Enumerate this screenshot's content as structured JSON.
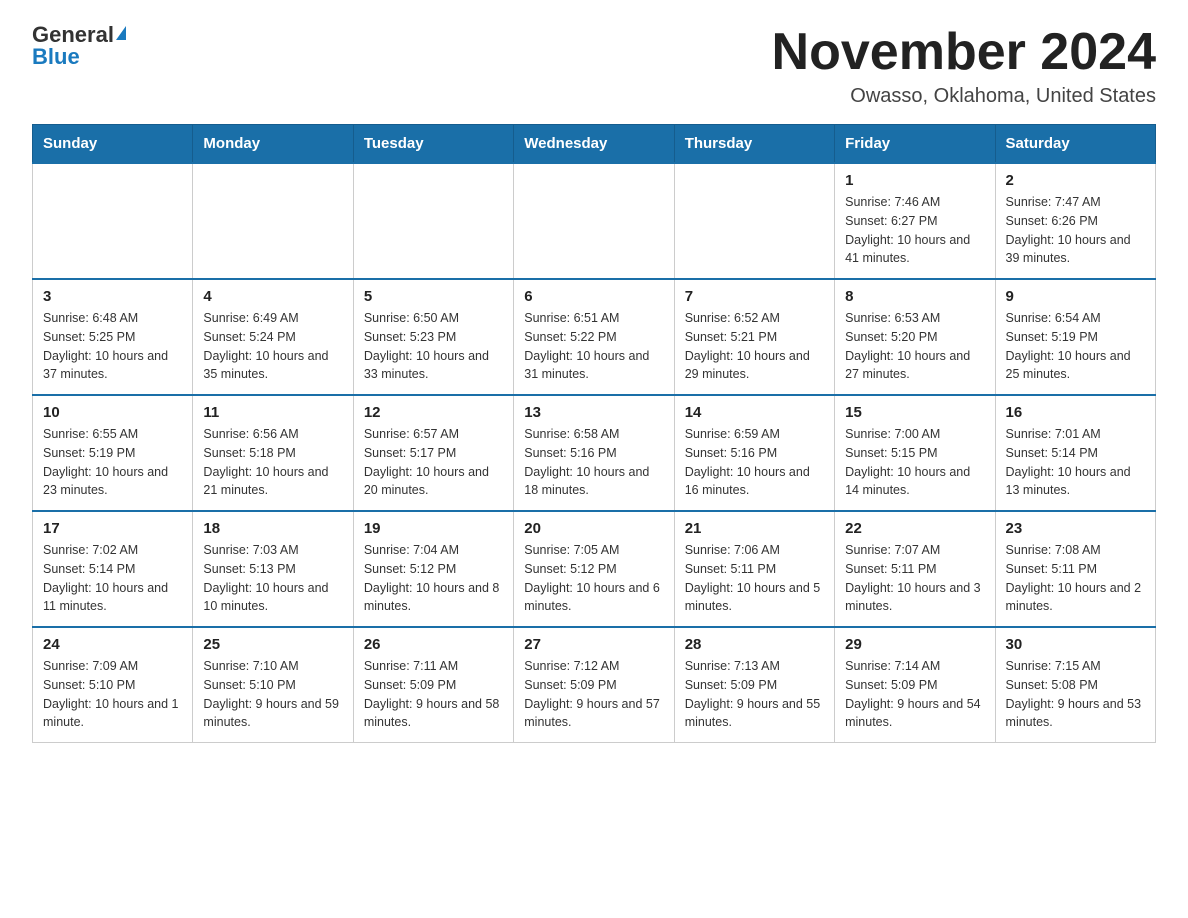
{
  "logo": {
    "general": "General",
    "blue": "Blue"
  },
  "title": "November 2024",
  "subtitle": "Owasso, Oklahoma, United States",
  "days_of_week": [
    "Sunday",
    "Monday",
    "Tuesday",
    "Wednesday",
    "Thursday",
    "Friday",
    "Saturday"
  ],
  "weeks": [
    [
      {
        "day": "",
        "info": ""
      },
      {
        "day": "",
        "info": ""
      },
      {
        "day": "",
        "info": ""
      },
      {
        "day": "",
        "info": ""
      },
      {
        "day": "",
        "info": ""
      },
      {
        "day": "1",
        "info": "Sunrise: 7:46 AM\nSunset: 6:27 PM\nDaylight: 10 hours and 41 minutes."
      },
      {
        "day": "2",
        "info": "Sunrise: 7:47 AM\nSunset: 6:26 PM\nDaylight: 10 hours and 39 minutes."
      }
    ],
    [
      {
        "day": "3",
        "info": "Sunrise: 6:48 AM\nSunset: 5:25 PM\nDaylight: 10 hours and 37 minutes."
      },
      {
        "day": "4",
        "info": "Sunrise: 6:49 AM\nSunset: 5:24 PM\nDaylight: 10 hours and 35 minutes."
      },
      {
        "day": "5",
        "info": "Sunrise: 6:50 AM\nSunset: 5:23 PM\nDaylight: 10 hours and 33 minutes."
      },
      {
        "day": "6",
        "info": "Sunrise: 6:51 AM\nSunset: 5:22 PM\nDaylight: 10 hours and 31 minutes."
      },
      {
        "day": "7",
        "info": "Sunrise: 6:52 AM\nSunset: 5:21 PM\nDaylight: 10 hours and 29 minutes."
      },
      {
        "day": "8",
        "info": "Sunrise: 6:53 AM\nSunset: 5:20 PM\nDaylight: 10 hours and 27 minutes."
      },
      {
        "day": "9",
        "info": "Sunrise: 6:54 AM\nSunset: 5:19 PM\nDaylight: 10 hours and 25 minutes."
      }
    ],
    [
      {
        "day": "10",
        "info": "Sunrise: 6:55 AM\nSunset: 5:19 PM\nDaylight: 10 hours and 23 minutes."
      },
      {
        "day": "11",
        "info": "Sunrise: 6:56 AM\nSunset: 5:18 PM\nDaylight: 10 hours and 21 minutes."
      },
      {
        "day": "12",
        "info": "Sunrise: 6:57 AM\nSunset: 5:17 PM\nDaylight: 10 hours and 20 minutes."
      },
      {
        "day": "13",
        "info": "Sunrise: 6:58 AM\nSunset: 5:16 PM\nDaylight: 10 hours and 18 minutes."
      },
      {
        "day": "14",
        "info": "Sunrise: 6:59 AM\nSunset: 5:16 PM\nDaylight: 10 hours and 16 minutes."
      },
      {
        "day": "15",
        "info": "Sunrise: 7:00 AM\nSunset: 5:15 PM\nDaylight: 10 hours and 14 minutes."
      },
      {
        "day": "16",
        "info": "Sunrise: 7:01 AM\nSunset: 5:14 PM\nDaylight: 10 hours and 13 minutes."
      }
    ],
    [
      {
        "day": "17",
        "info": "Sunrise: 7:02 AM\nSunset: 5:14 PM\nDaylight: 10 hours and 11 minutes."
      },
      {
        "day": "18",
        "info": "Sunrise: 7:03 AM\nSunset: 5:13 PM\nDaylight: 10 hours and 10 minutes."
      },
      {
        "day": "19",
        "info": "Sunrise: 7:04 AM\nSunset: 5:12 PM\nDaylight: 10 hours and 8 minutes."
      },
      {
        "day": "20",
        "info": "Sunrise: 7:05 AM\nSunset: 5:12 PM\nDaylight: 10 hours and 6 minutes."
      },
      {
        "day": "21",
        "info": "Sunrise: 7:06 AM\nSunset: 5:11 PM\nDaylight: 10 hours and 5 minutes."
      },
      {
        "day": "22",
        "info": "Sunrise: 7:07 AM\nSunset: 5:11 PM\nDaylight: 10 hours and 3 minutes."
      },
      {
        "day": "23",
        "info": "Sunrise: 7:08 AM\nSunset: 5:11 PM\nDaylight: 10 hours and 2 minutes."
      }
    ],
    [
      {
        "day": "24",
        "info": "Sunrise: 7:09 AM\nSunset: 5:10 PM\nDaylight: 10 hours and 1 minute."
      },
      {
        "day": "25",
        "info": "Sunrise: 7:10 AM\nSunset: 5:10 PM\nDaylight: 9 hours and 59 minutes."
      },
      {
        "day": "26",
        "info": "Sunrise: 7:11 AM\nSunset: 5:09 PM\nDaylight: 9 hours and 58 minutes."
      },
      {
        "day": "27",
        "info": "Sunrise: 7:12 AM\nSunset: 5:09 PM\nDaylight: 9 hours and 57 minutes."
      },
      {
        "day": "28",
        "info": "Sunrise: 7:13 AM\nSunset: 5:09 PM\nDaylight: 9 hours and 55 minutes."
      },
      {
        "day": "29",
        "info": "Sunrise: 7:14 AM\nSunset: 5:09 PM\nDaylight: 9 hours and 54 minutes."
      },
      {
        "day": "30",
        "info": "Sunrise: 7:15 AM\nSunset: 5:08 PM\nDaylight: 9 hours and 53 minutes."
      }
    ]
  ]
}
